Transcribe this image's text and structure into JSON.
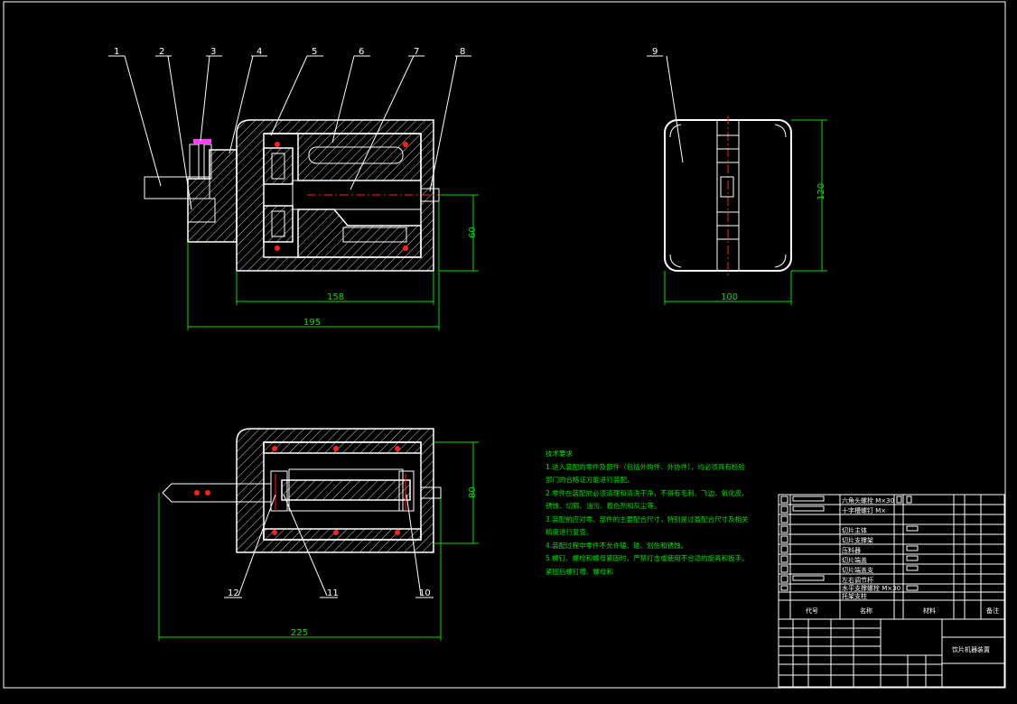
{
  "drawing": {
    "part_labels": [
      "1",
      "2",
      "3",
      "4",
      "5",
      "6",
      "7",
      "8",
      "9",
      "10",
      "11",
      "12"
    ],
    "dimensions": {
      "front_height": "60",
      "front_width_inner": "158",
      "front_width_overall": "195",
      "side_height": "120",
      "side_width": "100",
      "top_height": "80",
      "top_width": "225"
    }
  },
  "notes": {
    "title": "技术要求",
    "lines": [
      "1.进入装配的零件及部件（包括外购件、外协件），均必须具有检验",
      "部门的合格证方能进行装配。",
      "2.零件在装配前必须清理和清洗干净，不得有毛刺、飞边、氧化皮、",
      "锈蚀、切屑、油污、着色剂和灰尘等。",
      "3.装配前应对零、部件的主要配合尺寸，特别是过盈配合尺寸及相关",
      "精度进行复查。",
      "4.装配过程中零件不允许磕、碰、划伤和锈蚀。",
      "5.螺钉、螺栓和螺母紧固时，严禁打击或使用不合适的旋具和扳手。",
      "紧固后螺钉槽、螺母和"
    ]
  },
  "title_block": {
    "col_code": "代号",
    "col_name": "名称",
    "col_material": "材料",
    "col_remark": "备注",
    "drawing_title": "饮片机器装置",
    "row_texts": [
      "六角头螺栓 M×30",
      "十字槽螺钉 M×",
      "切片主体",
      "切片支撑架",
      "压料器",
      "切片端盖",
      "切片端盖支",
      "左右调节杆",
      "水平支撑螺栓 M×30",
      "托架支柱"
    ]
  },
  "colors": {
    "line": "#ffffff",
    "text": "#00e000",
    "hole": "#ff2020",
    "accent": "#ff40ff"
  }
}
